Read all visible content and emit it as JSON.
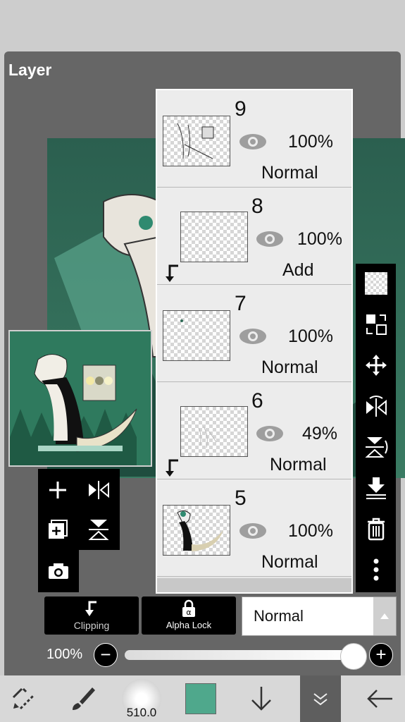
{
  "panel": {
    "title": "Layer"
  },
  "layers": [
    {
      "number": "9",
      "opacity": "100%",
      "blend": "Normal",
      "clipped": false
    },
    {
      "number": "8",
      "opacity": "100%",
      "blend": "Add",
      "clipped": true
    },
    {
      "number": "7",
      "opacity": "100%",
      "blend": "Normal",
      "clipped": false
    },
    {
      "number": "6",
      "opacity": "49%",
      "blend": "Normal",
      "clipped": true
    },
    {
      "number": "5",
      "opacity": "100%",
      "blend": "Normal",
      "clipped": false
    }
  ],
  "controls": {
    "clipping_label": "Clipping",
    "alpha_lock_label": "Alpha Lock",
    "blend_mode": "Normal",
    "opacity_label": "100%",
    "opacity_value": 1.0
  },
  "bottom": {
    "brush_size": "510.0",
    "color": "#4fa88c"
  },
  "icons": {
    "left_tools": [
      "add-layer-icon",
      "flip-horizontal-icon",
      "duplicate-layer-icon",
      "flip-vertical-icon",
      "camera-icon"
    ],
    "right_tools": [
      "transparency-icon",
      "swap-layer-icon",
      "move-icon",
      "flip-h-icon",
      "flip-v-icon",
      "merge-down-icon",
      "trash-icon",
      "more-icon"
    ]
  }
}
